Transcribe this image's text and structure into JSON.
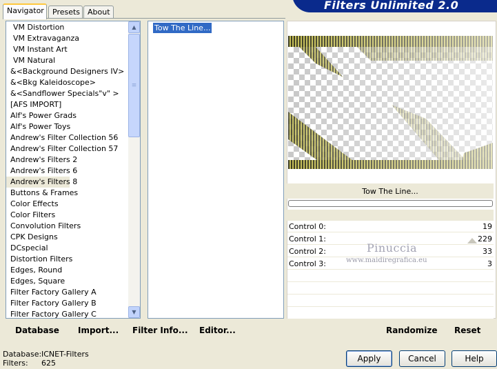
{
  "tabs": [
    "Navigator",
    "Presets",
    "About"
  ],
  "banner_title": "Filters Unlimited 2.0",
  "categories": [
    "VM Distortion",
    "VM Extravaganza",
    "VM Instant Art",
    "VM Natural",
    "&<Background Designers IV>",
    "&<Bkg Kaleidoscope>",
    "&<Sandflower Specials\"v\" >",
    "[AFS IMPORT]",
    "Alf's Power Grads",
    "Alf's Power Toys",
    "Andrew's Filter Collection 56",
    "Andrew's Filter Collection 57",
    "Andrew's Filters 2",
    "Andrew's Filters 6",
    "Andrew's Filters 8",
    "Buttons & Frames",
    "Color Effects",
    "Color Filters",
    "Convolution Filters",
    "CPK Designs",
    "DCspecial",
    "Distortion Filters",
    "Edges, Round",
    "Edges, Square",
    "Filter Factory Gallery A",
    "Filter Factory Gallery B",
    "Filter Factory Gallery C"
  ],
  "selected_category": "Andrew's Filters 8",
  "filters": [
    "Tow The Line..."
  ],
  "selected_filter_name": "Tow The Line...",
  "controls": [
    {
      "label": "Control 0:",
      "value": "19"
    },
    {
      "label": "Control 1:",
      "value": "229"
    },
    {
      "label": "Control 2:",
      "value": "33"
    },
    {
      "label": "Control 3:",
      "value": "3"
    }
  ],
  "watermark": {
    "name": "Pinuccia",
    "url": "www.maidiregrafica.eu"
  },
  "toolbar": {
    "database": "Database",
    "import": "Import...",
    "filter_info": "Filter Info...",
    "editor": "Editor...",
    "randomize": "Randomize",
    "reset": "Reset"
  },
  "status": {
    "database_label": "Database:",
    "database_value": "ICNET-Filters",
    "filters_label": "Filters:",
    "filters_value": "625"
  },
  "buttons": {
    "apply": "Apply",
    "cancel": "Cancel",
    "help": "Help"
  },
  "colors": {
    "selection": "#316ac5",
    "banner": "#0a2a8c",
    "preview_stripe": "#b8b24a"
  }
}
